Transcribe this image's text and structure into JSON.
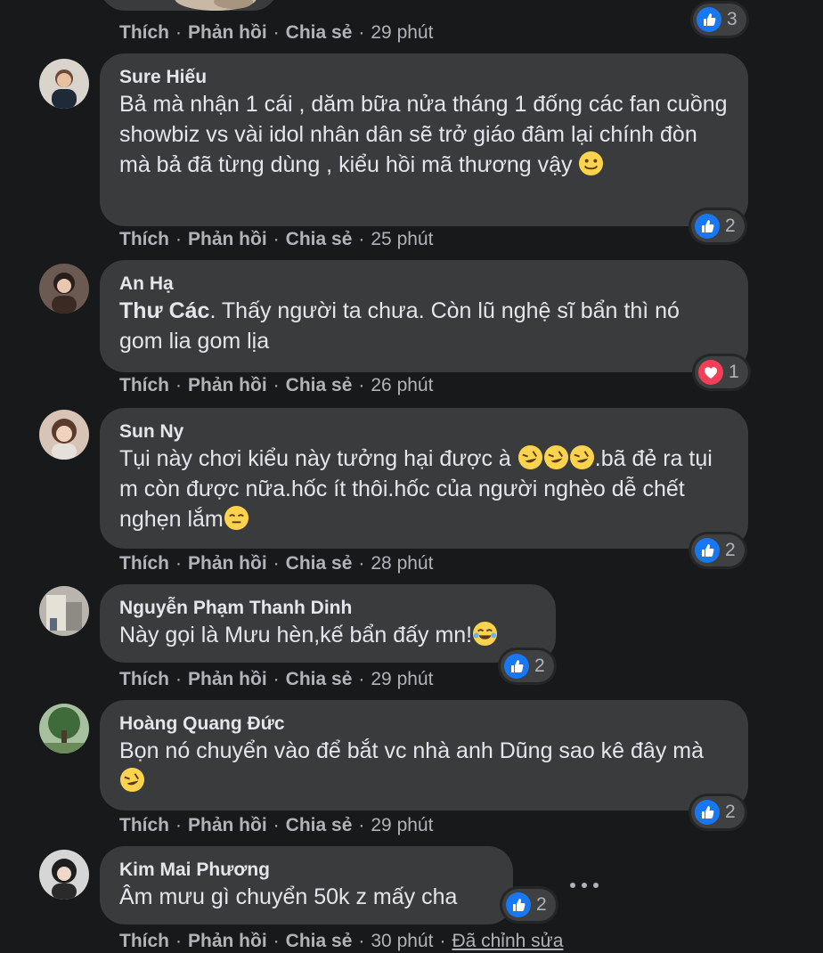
{
  "actions": {
    "like": "Thích",
    "reply": "Phản hồi",
    "share": "Chia sẻ"
  },
  "top": {
    "time": "29 phút",
    "reaction_count": "3"
  },
  "comments": [
    {
      "author": "Sure Hiếu",
      "text": "Bả mà nhận 1 cái , dăm bữa nửa tháng 1 đống các fan cuồng showbiz vs vài idol nhân dân sẽ trở giáo đâm lại chính đòn mà bả đã từng dùng , kiểu hồi mã thương vậy",
      "time": "25 phút",
      "reaction_count": "2",
      "reaction": "like"
    },
    {
      "author": "An Hạ",
      "mention": "Thư Các",
      "text": ". Thấy người ta chưa. Còn lũ nghệ sĩ bẩn thì nó gom lia gom lịa",
      "time": "26 phút",
      "reaction_count": "1",
      "reaction": "love"
    },
    {
      "author": "Sun Ny",
      "text_a": "Tụi này chơi kiểu này tưởng hại được à",
      "text_b": ".bã đẻ ra tụi m còn được nữa.hốc ít thôi.hốc của người nghèo dễ chết nghẹn lắm",
      "time": "28 phút",
      "reaction_count": "2",
      "reaction": "like"
    },
    {
      "author": "Nguyễn Phạm Thanh Dinh",
      "text": "Này gọi là Mưu hèn,kế bẩn đấy mn!",
      "time": "29 phút",
      "reaction_count": "2",
      "reaction": "like"
    },
    {
      "author": "Hoàng Quang Đức",
      "text": "Bọn nó chuyển vào để bắt vc nhà anh Dũng sao kê đây mà",
      "time": "29 phút",
      "reaction_count": "2",
      "reaction": "like"
    },
    {
      "author": "Kim Mai Phương",
      "text": "Âm mưu gì chuyển 50k z mấy cha",
      "time": "30 phút",
      "edited": "Đã chỉnh sửa",
      "reaction_count": "2",
      "reaction": "like"
    }
  ],
  "colors": {
    "background": "#18191a",
    "bubble": "#3a3b3c",
    "text": "#e4e6eb",
    "muted": "#b0b3b8",
    "like_blue": "#1877f2",
    "love_red": "#f33e58"
  },
  "icons": [
    "like-icon",
    "love-icon",
    "smile-emoji",
    "rofl-emoji",
    "relieved-emoji",
    "tears-of-joy-emoji",
    "more-options-icon"
  ]
}
